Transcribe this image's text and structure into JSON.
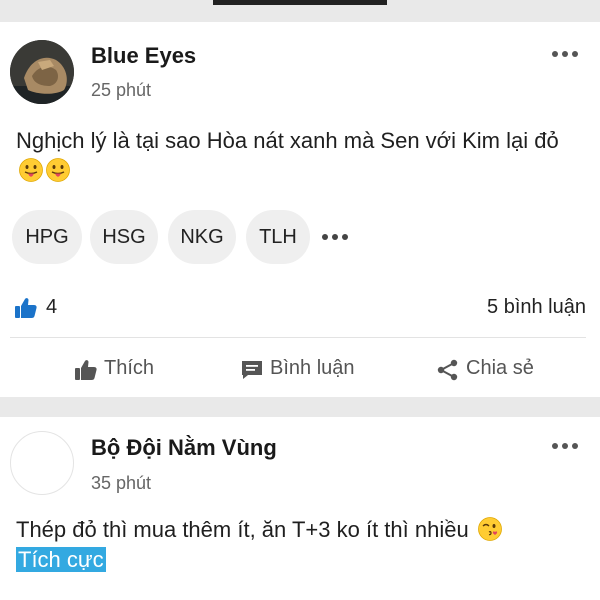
{
  "posts": [
    {
      "author": "Blue Eyes",
      "time": "25 phút",
      "text": "Nghịch lý là tại sao Hòa nát xanh mà Sen với Kim lại đỏ",
      "emojis": [
        "tongue-out-face",
        "tongue-out-face"
      ],
      "tags": [
        "HPG",
        "HSG",
        "NKG",
        "TLH"
      ],
      "like_count": "4",
      "comment_count": "5 bình luận",
      "actions": {
        "like": "Thích",
        "comment": "Bình luận",
        "share": "Chia sẻ"
      }
    },
    {
      "author": "Bộ Đội Nằm Vùng",
      "time": "35 phút",
      "text": "Thép đỏ thì mua thêm ít, ăn T+3 ko ít thì nhiều",
      "emojis": [
        "kissing-wink-face"
      ],
      "sentiment": "Tích cực"
    }
  ],
  "colors": {
    "like_blue": "#1b73c9",
    "highlight": "#33a9e1",
    "background_gray": "#e9e9e9"
  }
}
